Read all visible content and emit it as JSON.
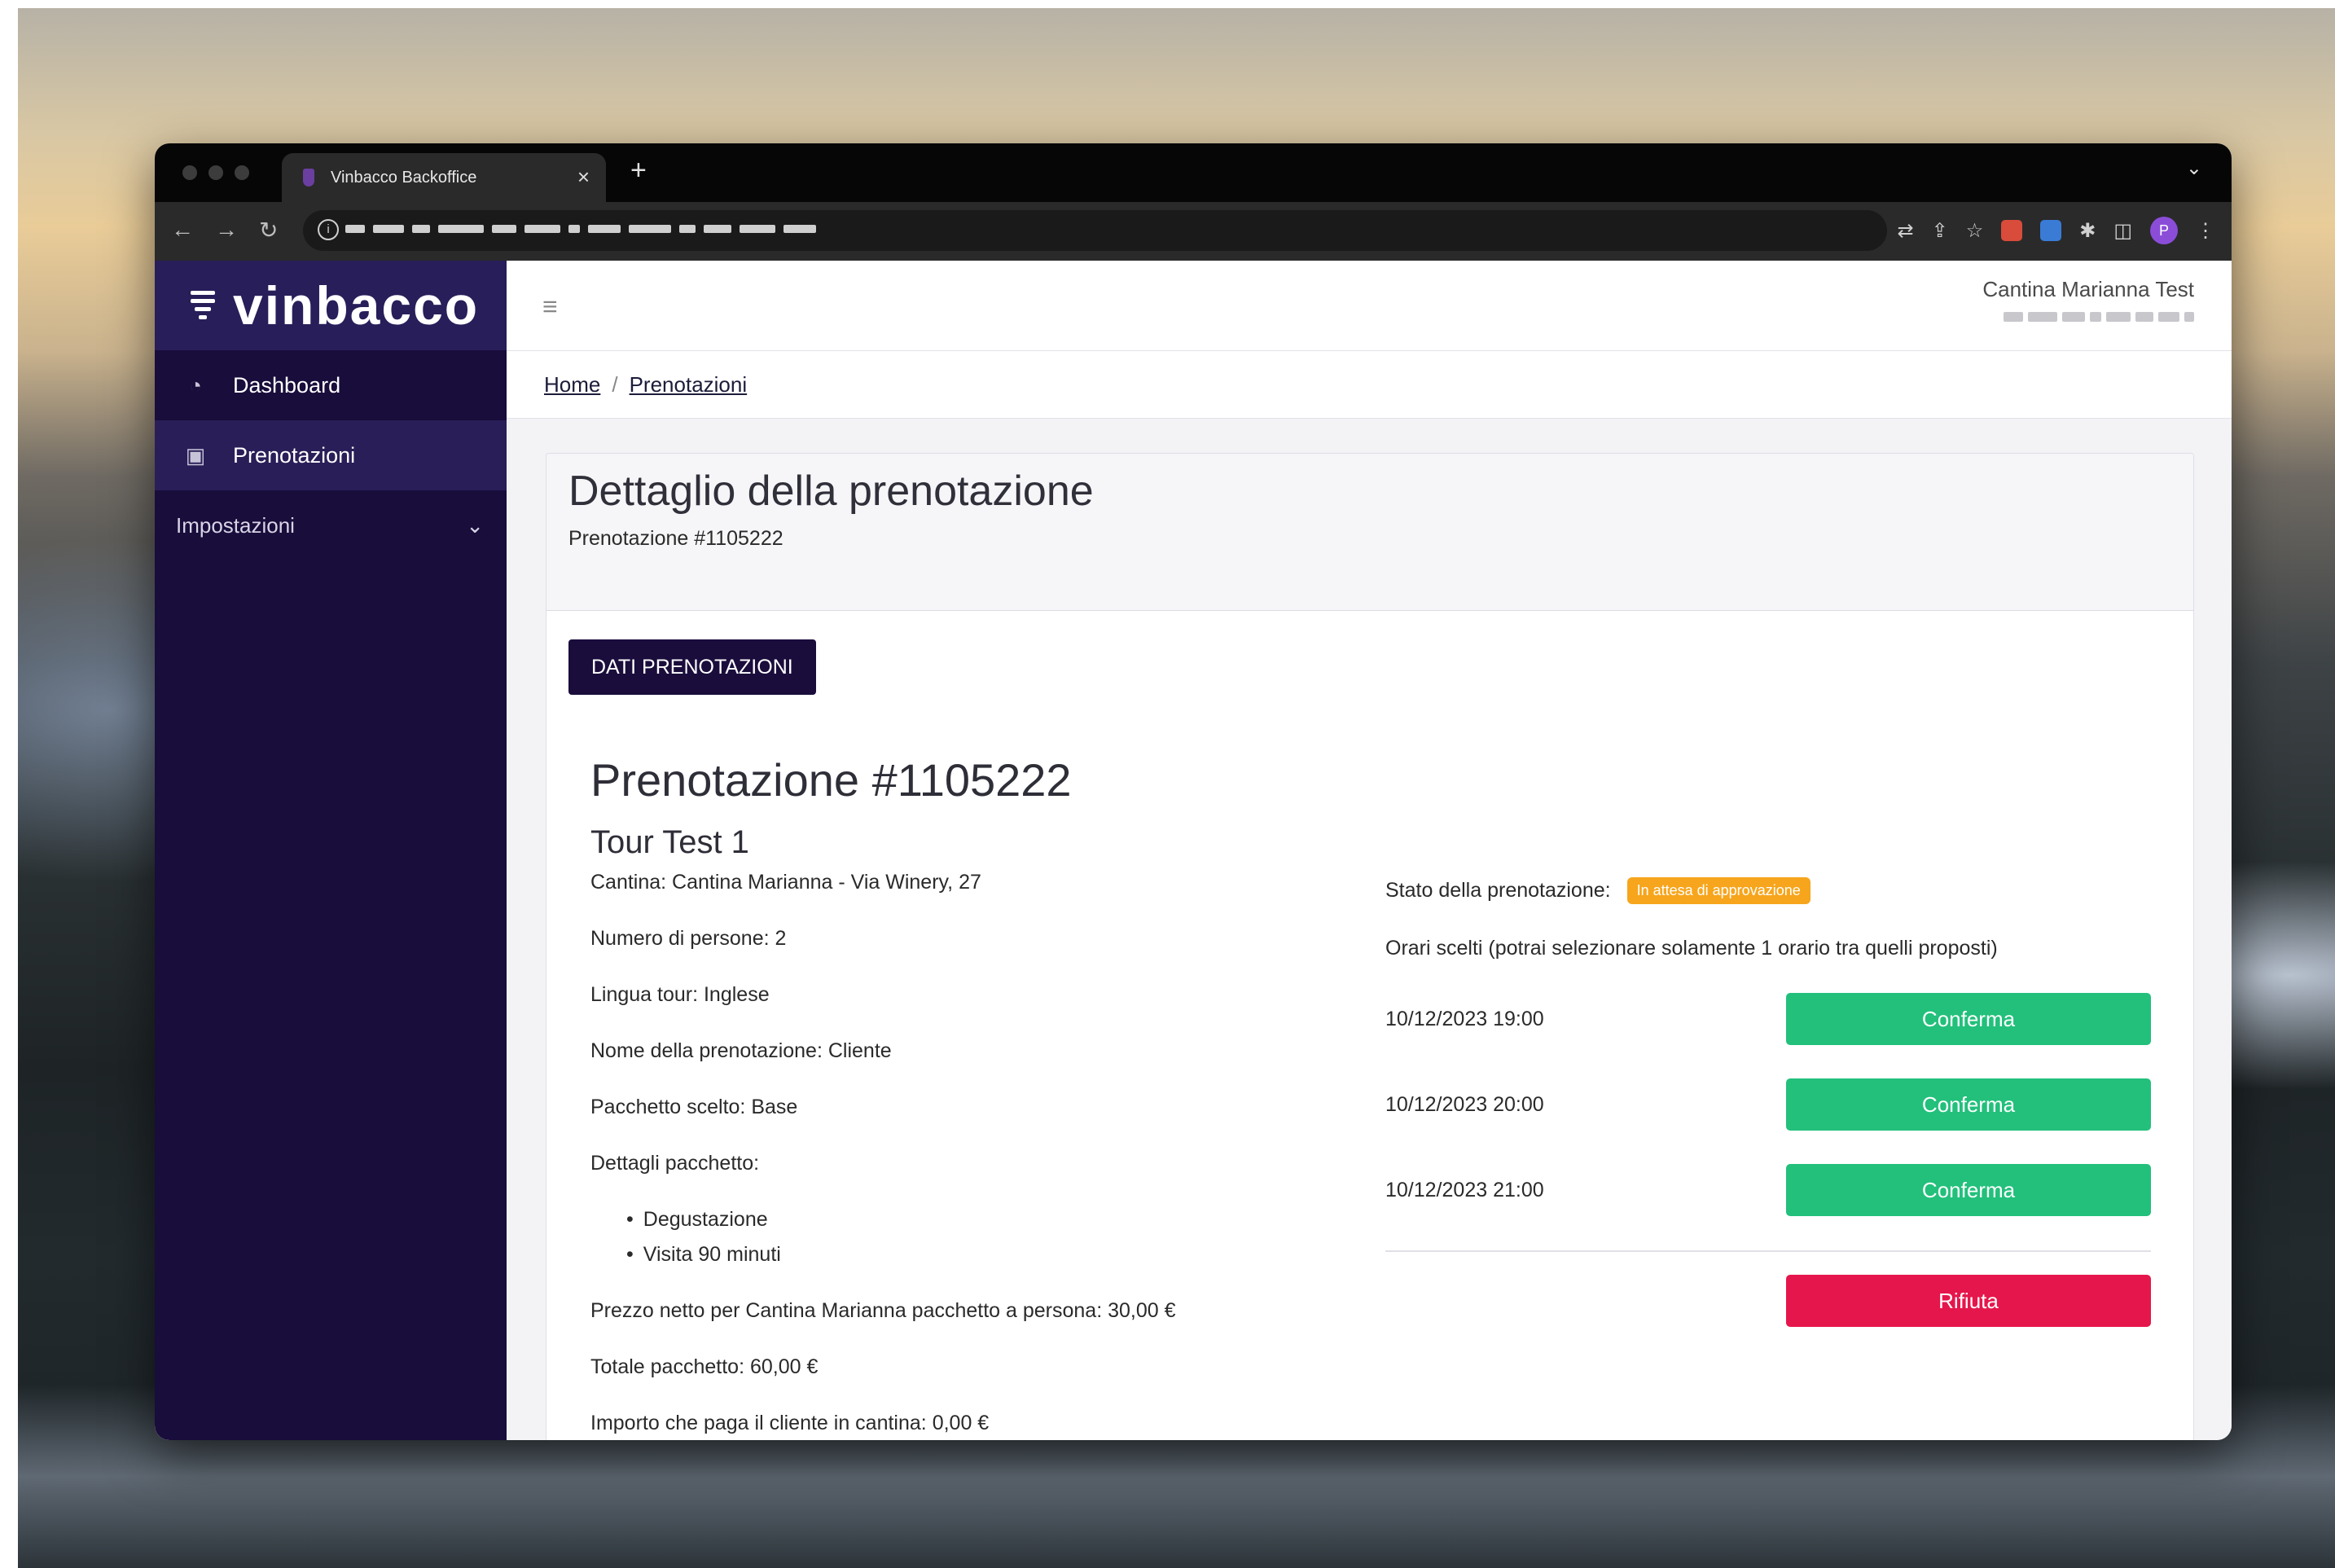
{
  "browser": {
    "tab_title": "Vinbacco Backoffice",
    "tab_close": "×",
    "new_tab": "+",
    "tab_menu": "⌄",
    "avatar_letter": "P"
  },
  "sidebar": {
    "brand": "vinbacco",
    "items": [
      {
        "label": "Dashboard",
        "icon": "dashboard-gauge-icon"
      },
      {
        "label": "Prenotazioni",
        "icon": "bookings-icon"
      }
    ],
    "group_label": "Impostazioni"
  },
  "topbar": {
    "user_name": "Cantina Marianna Test"
  },
  "breadcrumb": {
    "home": "Home",
    "separator": "/",
    "current": "Prenotazioni"
  },
  "card": {
    "title": "Dettaglio della prenotazione",
    "subtitle": "Prenotazione #1105222",
    "tab_label": "DATI PRENOTAZIONI"
  },
  "booking": {
    "heading": "Prenotazione #1105222",
    "tour": "Tour Test 1",
    "cantina": "Cantina: Cantina Marianna - Via Winery, 27",
    "persons": "Numero di persone: 2",
    "language": "Lingua tour: Inglese",
    "name": "Nome della prenotazione: Cliente",
    "package": "Pacchetto scelto: Base",
    "package_details_label": "Dettagli pacchetto:",
    "package_details": [
      "Degustazione",
      "Visita 90 minuti"
    ],
    "net_price": "Prezzo netto per Cantina Marianna pacchetto a persona: 30,00 €",
    "total": "Totale pacchetto: 60,00 €",
    "paid_at_winery": "Importo che paga il cliente in cantina: 0,00 €"
  },
  "status": {
    "label": "Stato della prenotazione:",
    "badge": "In attesa di approvazione",
    "badge_color": "#f7a51c",
    "hint": "Orari scelti (potrai selezionare solamente 1 orario tra quelli proposti)"
  },
  "slots": [
    {
      "time": "10/12/2023 19:00",
      "action": "Conferma"
    },
    {
      "time": "10/12/2023 20:00",
      "action": "Conferma"
    },
    {
      "time": "10/12/2023 21:00",
      "action": "Conferma"
    }
  ],
  "reject_label": "Rifiuta",
  "colors": {
    "sidebar": "#180d3b",
    "confirm": "#22c07b",
    "reject": "#e5164b"
  }
}
